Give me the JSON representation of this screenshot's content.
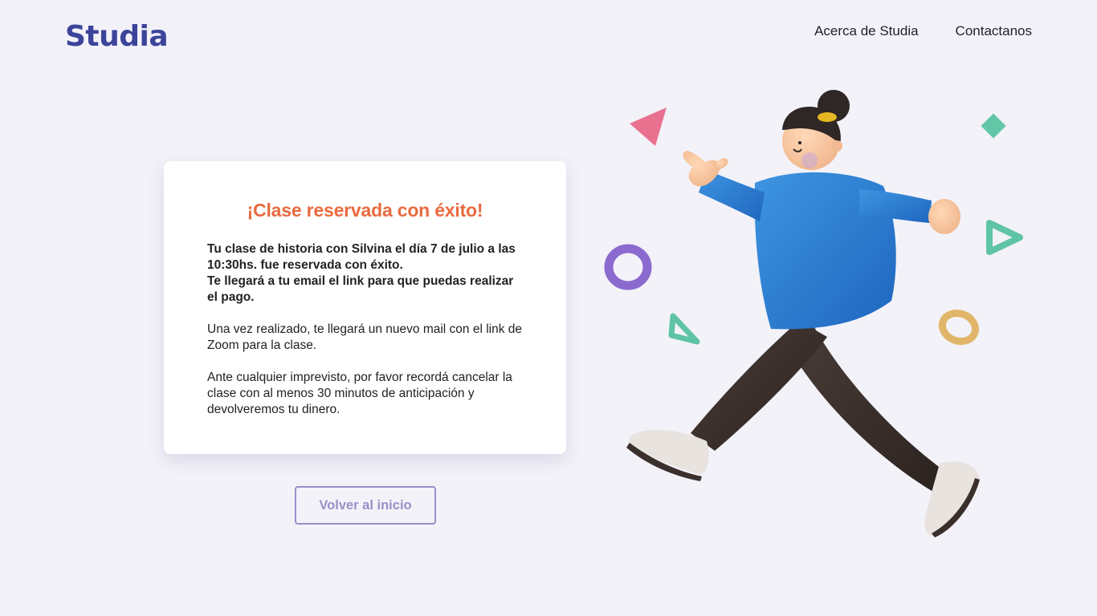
{
  "header": {
    "logo_text": "Studia",
    "nav": [
      {
        "label": "Acerca de Studia"
      },
      {
        "label": "Contactanos"
      }
    ]
  },
  "confirmation": {
    "title": "¡Clase reservada con éxito!",
    "bold_line_1": "Tu clase de historia con Silvina el día 7 de julio a las 10:30hs. fue reservada con éxito.",
    "bold_line_2": "Te llegará a tu email el link para que puedas realizar el pago.",
    "paragraph_1": "Una vez realizado, te llegará un nuevo mail con el link de Zoom para la clase.",
    "paragraph_2": "Ante cualquier imprevisto, por favor recordá cancelar la clase con al menos 30 minutos de anticipación y devolveremos tu dinero."
  },
  "actions": {
    "back_label": "Volver al inicio"
  },
  "colors": {
    "brand": "#3c449a",
    "accent": "#e96a3f",
    "button_outline": "#9a8fc8",
    "background": "#f3f2f9"
  },
  "illustration": {
    "name": "walking-person-illustration"
  }
}
